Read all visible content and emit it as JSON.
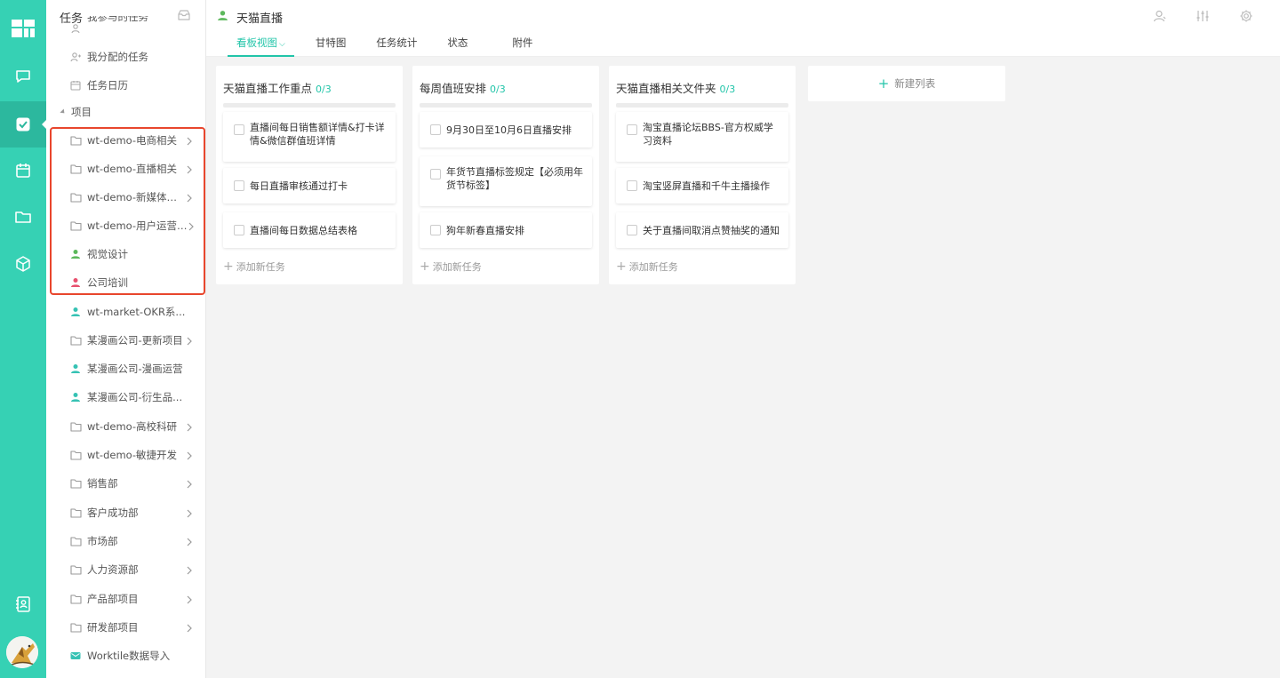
{
  "colors": {
    "accent": "#22c5a9",
    "rail": "#36d1b4",
    "highlight": "#e8462d"
  },
  "rail": {
    "items": [
      {
        "icon": "app-grid-icon"
      },
      {
        "icon": "chat-icon"
      },
      {
        "icon": "task-check-icon",
        "active": true
      },
      {
        "icon": "calendar-icon"
      },
      {
        "icon": "folder-icon"
      },
      {
        "icon": "cube-icon"
      },
      {
        "icon": "contacts-icon"
      }
    ]
  },
  "sidebar": {
    "title": "任务",
    "partial_top": "我参与的任务",
    "items": [
      {
        "label": "我分配的任务",
        "icon": "assign-icon"
      },
      {
        "label": "任务日历",
        "icon": "calendar-icon"
      }
    ],
    "section_label": "项目",
    "projects": [
      {
        "label": "wt-demo-电商相关",
        "icon": "folder-icon",
        "chevron": true
      },
      {
        "label": "wt-demo-直播相关",
        "icon": "folder-icon",
        "chevron": true
      },
      {
        "label": "wt-demo-新媒体相关",
        "icon": "folder-icon",
        "chevron": true
      },
      {
        "label": "wt-demo-用户运营相关",
        "icon": "folder-icon",
        "chevron": true
      },
      {
        "label": "视觉设计",
        "icon": "user-icon",
        "icon_color": "#5cb85c",
        "chevron": false
      },
      {
        "label": "公司培训",
        "icon": "user-icon",
        "icon_color": "#e8506e",
        "chevron": false
      },
      {
        "label": "wt-market-OKR系...",
        "icon": "user-icon",
        "icon_color": "#36c2b4",
        "chevron": false
      },
      {
        "label": "某漫画公司-更新项目",
        "icon": "folder-icon",
        "chevron": true
      },
      {
        "label": "某漫画公司-漫画运营",
        "icon": "user-icon",
        "icon_color": "#36c2b4",
        "chevron": false
      },
      {
        "label": "某漫画公司-衍生品...",
        "icon": "user-icon",
        "icon_color": "#36c2b4",
        "chevron": false
      },
      {
        "label": "wt-demo-高校科研",
        "icon": "folder-icon",
        "chevron": true
      },
      {
        "label": "wt-demo-敏捷开发",
        "icon": "folder-icon",
        "chevron": true
      },
      {
        "label": "销售部",
        "icon": "folder-icon",
        "chevron": true
      },
      {
        "label": "客户成功部",
        "icon": "folder-icon",
        "chevron": true
      },
      {
        "label": "市场部",
        "icon": "folder-icon",
        "chevron": true
      },
      {
        "label": "人力资源部",
        "icon": "folder-icon",
        "chevron": true
      },
      {
        "label": "产品部项目",
        "icon": "folder-icon",
        "chevron": true
      },
      {
        "label": "研发部项目",
        "icon": "folder-icon",
        "chevron": true
      },
      {
        "label": "Worktile数据导入",
        "icon": "mail-icon",
        "icon_color": "#36c2b4",
        "chevron": false
      }
    ]
  },
  "header": {
    "title": "天猫直播",
    "tabs": [
      {
        "label": "看板视图",
        "active": true
      },
      {
        "label": "甘特图"
      },
      {
        "label": "任务统计"
      },
      {
        "label": "状态"
      },
      {
        "label": "附件"
      }
    ]
  },
  "board": {
    "columns": [
      {
        "title": "天猫直播工作重点",
        "count": "0/3",
        "cards": [
          "直播间每日销售额详情&打卡详情&微信群值班详情",
          "每日直播审核通过打卡",
          "直播间每日数据总结表格"
        ],
        "add_label": "添加新任务"
      },
      {
        "title": "每周值班安排",
        "count": "0/3",
        "cards": [
          "9月30日至10月6日直播安排",
          "年货节直播标签规定【必须用年货节标签】",
          "狗年新春直播安排"
        ],
        "add_label": "添加新任务"
      },
      {
        "title": "天猫直播相关文件夹",
        "count": "0/3",
        "cards": [
          "淘宝直播论坛BBS-官方权威学习资料",
          "淘宝竖屏直播和千牛主播操作",
          "关于直播间取消点赞抽奖的通知"
        ],
        "add_label": "添加新任务"
      }
    ],
    "new_list_label": "新建列表"
  }
}
